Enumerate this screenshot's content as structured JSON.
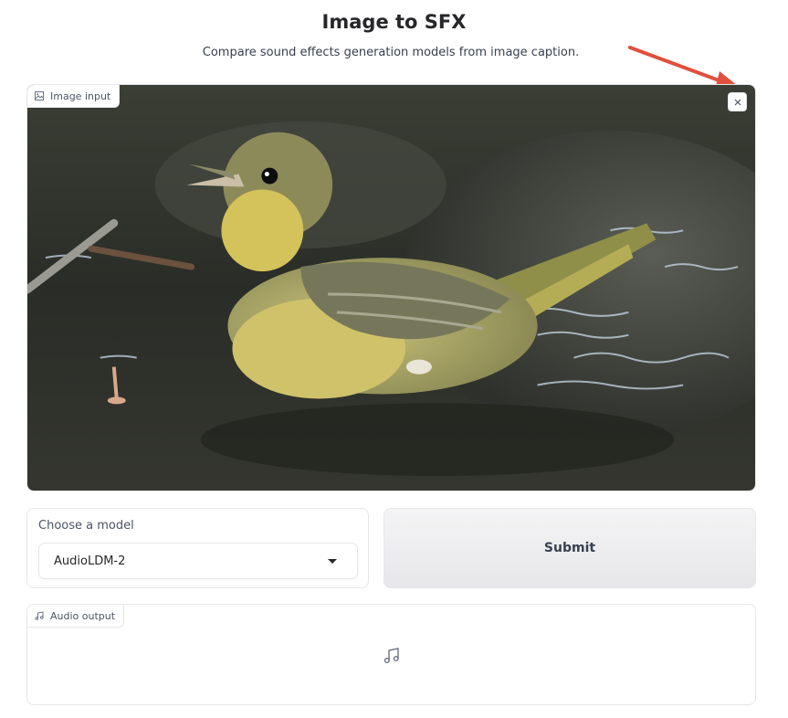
{
  "header": {
    "title": "Image to SFX",
    "subtitle": "Compare sound effects generation models from image caption."
  },
  "image_input": {
    "label": "Image input",
    "icon": "image-icon",
    "close_icon": "close-icon"
  },
  "model": {
    "label": "Choose a model",
    "selected": "AudioLDM-2"
  },
  "submit": {
    "label": "Submit"
  },
  "audio_output": {
    "label": "Audio output",
    "icon": "music-icon"
  },
  "colors": {
    "annotation_arrow": "#e0503e",
    "border": "#e5e7eb",
    "text": "#27272a"
  }
}
